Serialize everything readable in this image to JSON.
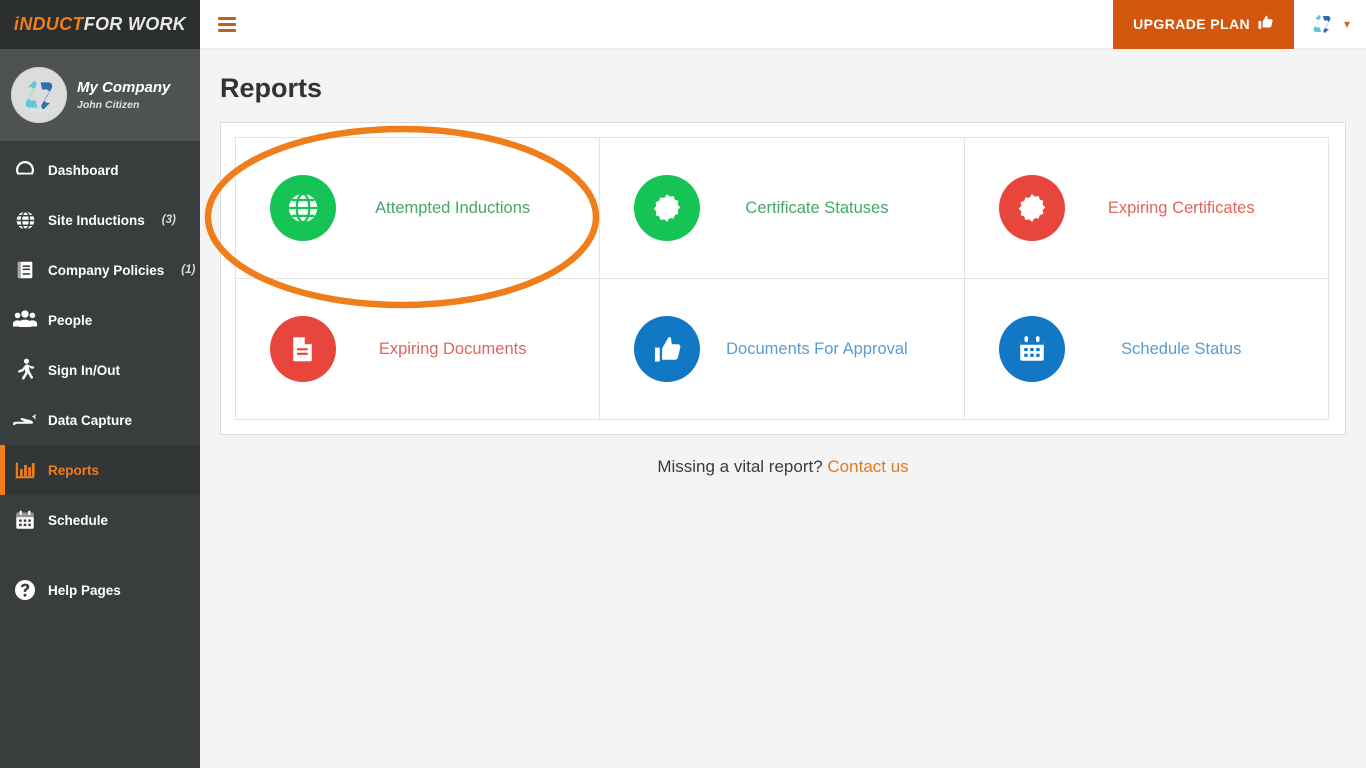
{
  "brand": {
    "logo_first": "iNDUCT",
    "logo_second": "FOR WORK",
    "accent_orange": "#ef7d1a",
    "upgrade_orange": "#d2570d",
    "sidebar_bg": "#3a3d3d",
    "sidebar_dark": "#2b2e2e",
    "profile_bg": "#4e5252"
  },
  "profile": {
    "company": "My Company",
    "user": "John Citizen",
    "avatar_icon": "company-logo-icon"
  },
  "sidebar": {
    "items": [
      {
        "label": "Dashboard",
        "badge": "",
        "icon": "dashboard-gauge-icon",
        "active": false
      },
      {
        "label": "Site Inductions",
        "badge": "(3)",
        "icon": "globe-icon",
        "active": false
      },
      {
        "label": "Company Policies",
        "badge": "(1)",
        "icon": "book-icon",
        "active": false
      },
      {
        "label": "People",
        "badge": "",
        "icon": "people-icon",
        "active": false
      },
      {
        "label": "Sign In/Out",
        "badge": "",
        "icon": "walking-person-icon",
        "active": false
      },
      {
        "label": "Data Capture",
        "badge": "",
        "icon": "hand-capture-icon",
        "active": false
      },
      {
        "label": "Reports",
        "badge": "",
        "icon": "bar-chart-icon",
        "active": true
      },
      {
        "label": "Schedule",
        "badge": "",
        "icon": "calendar-icon",
        "active": false
      },
      {
        "label": "Help Pages",
        "badge": "",
        "icon": "question-mark-icon",
        "active": false
      }
    ]
  },
  "topbar": {
    "menu_toggle_icon": "hamburger-icon",
    "upgrade_label": "UPGRADE PLAN",
    "upgrade_icon": "thumbs-up-icon",
    "user_avatar_icon": "company-logo-icon",
    "caret_icon": "chevron-down-icon"
  },
  "page": {
    "title": "Reports"
  },
  "reports": {
    "cards": [
      {
        "label": "Attempted Inductions",
        "icon": "globe-icon",
        "color": "#15c455",
        "text_color": "#45a86a"
      },
      {
        "label": "Certificate Statuses",
        "icon": "certificate-icon",
        "color": "#15c455",
        "text_color": "#45a86a"
      },
      {
        "label": "Expiring Certificates",
        "icon": "certificate-icon",
        "color": "#e8453c",
        "text_color": "#e0655c"
      },
      {
        "label": "Expiring Documents",
        "icon": "document-icon",
        "color": "#e8453c",
        "text_color": "#e0655c"
      },
      {
        "label": "Documents For Approval",
        "icon": "thumbs-up-icon",
        "color": "#1277c4",
        "text_color": "#5b9bd1"
      },
      {
        "label": "Schedule Status",
        "icon": "calendar-icon",
        "color": "#1277c4",
        "text_color": "#5b9bd1"
      }
    ]
  },
  "footer": {
    "text": "Missing a vital report?",
    "link": "Contact us"
  },
  "annotation": {
    "shape": "ellipse-highlight",
    "color": "#ef7d1a",
    "target": "Attempted Inductions"
  }
}
